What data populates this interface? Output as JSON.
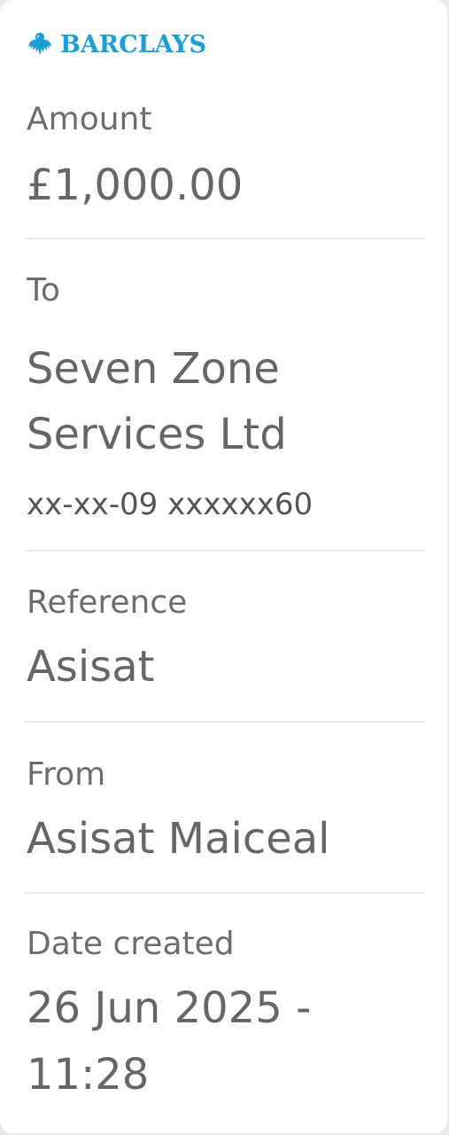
{
  "brand": {
    "name": "BARCLAYS",
    "logo_icon": "eagle-icon",
    "color": "#1a9fd8"
  },
  "amount": {
    "label": "Amount",
    "value": "£1,000.00"
  },
  "to": {
    "label": "To",
    "name_line1": "Seven Zone",
    "name_line2": "Services Ltd",
    "account": "xx-xx-09 xxxxxx60"
  },
  "reference": {
    "label": "Reference",
    "value": "Asisat"
  },
  "from": {
    "label": "From",
    "value": "Asisat Maiceal"
  },
  "date_created": {
    "label": "Date created",
    "line1": "26 Jun 2025 -",
    "line2": "11:28"
  }
}
